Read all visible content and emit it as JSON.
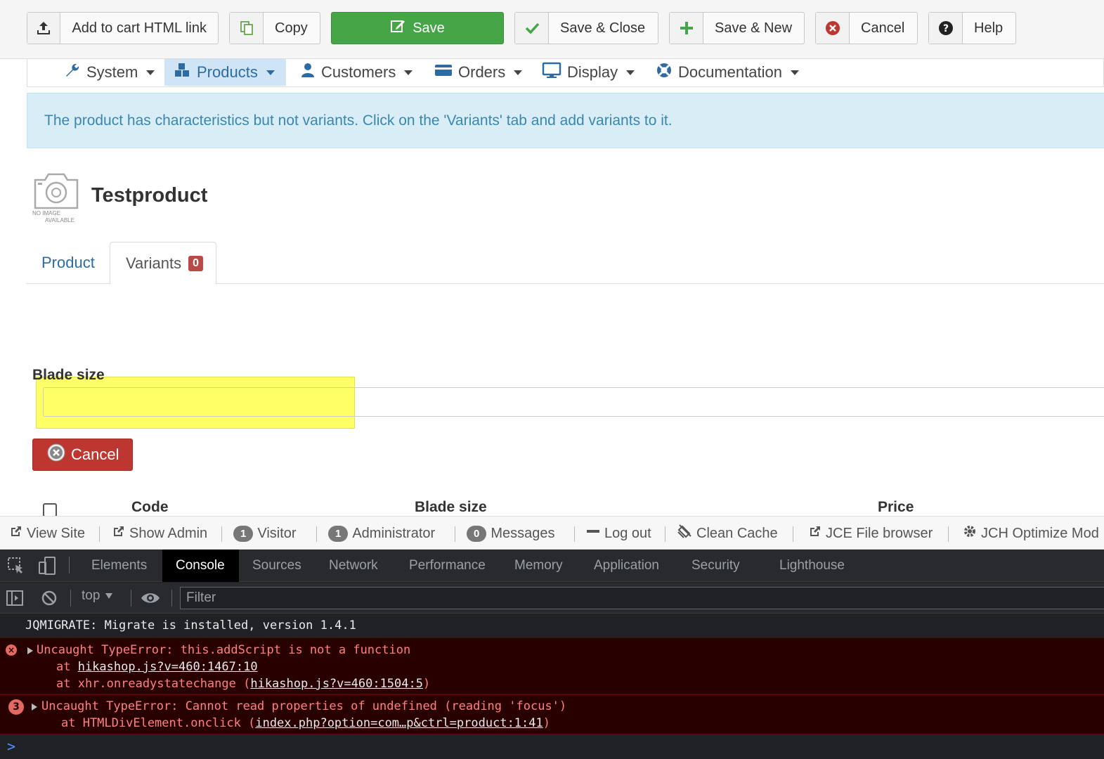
{
  "toolbar": {
    "add_to_cart": "Add to cart HTML link",
    "copy": "Copy",
    "save": "Save",
    "save_close": "Save & Close",
    "save_new": "Save & New",
    "cancel": "Cancel",
    "help": "Help"
  },
  "nav": {
    "items": [
      "System",
      "Products",
      "Customers",
      "Orders",
      "Display",
      "Documentation"
    ],
    "active": "Products"
  },
  "alert": {
    "message": "The product has characteristics but not variants. Click on the 'Variants' tab and add variants to it."
  },
  "product": {
    "title": "Testproduct",
    "no_image_line1": "NO IMAGE",
    "no_image_line2": "AVAILABLE"
  },
  "tabs": {
    "product": "Product",
    "variants": "Variants",
    "variants_count": "0"
  },
  "form": {
    "field_label": "Blade size",
    "field_value": "",
    "cancel": "Cancel"
  },
  "table": {
    "columns": [
      "Code",
      "Blade size",
      "Price"
    ]
  },
  "statusbar": {
    "view_site": "View Site",
    "show_admin": "Show Admin",
    "visitor_count": "1",
    "visitor": "Visitor",
    "admin_count": "1",
    "administrator": "Administrator",
    "messages_count": "0",
    "messages": "Messages",
    "logout": "Log out",
    "clean_cache": "Clean Cache",
    "jce": "JCE File browser",
    "jch": "JCH Optimize Mod"
  },
  "devtools": {
    "tabs": [
      "Elements",
      "Console",
      "Sources",
      "Network",
      "Performance",
      "Memory",
      "Application",
      "Security",
      "Lighthouse"
    ],
    "active_tab": "Console",
    "context": "top",
    "filter_placeholder": "Filter",
    "log": "JQMIGRATE: Migrate is installed, version 1.4.1",
    "error1": {
      "message": "Uncaught TypeError: this.addScript is not a function",
      "at1_prefix": "at ",
      "at1_link": "hikashop.js?v=460:1467:10",
      "at2_prefix": "at xhr.onreadystatechange (",
      "at2_link": "hikashop.js?v=460:1504:5",
      "at2_suffix": ")"
    },
    "error2": {
      "count": "3",
      "message": "Uncaught TypeError: Cannot read properties of undefined (reading 'focus')",
      "at_prefix": "at HTMLDivElement.onclick (",
      "at_link": "index.php?option=com…p&ctrl=product:1:41",
      "at_suffix": ")"
    },
    "prompt": ">"
  },
  "colors": {
    "save_green": "#46a546",
    "cancel_red": "#bd362f",
    "alert_bg": "#d9edf7",
    "highlight_yellow": "#ffff66",
    "devtools_bg": "#202124",
    "error_bg": "#290000"
  }
}
